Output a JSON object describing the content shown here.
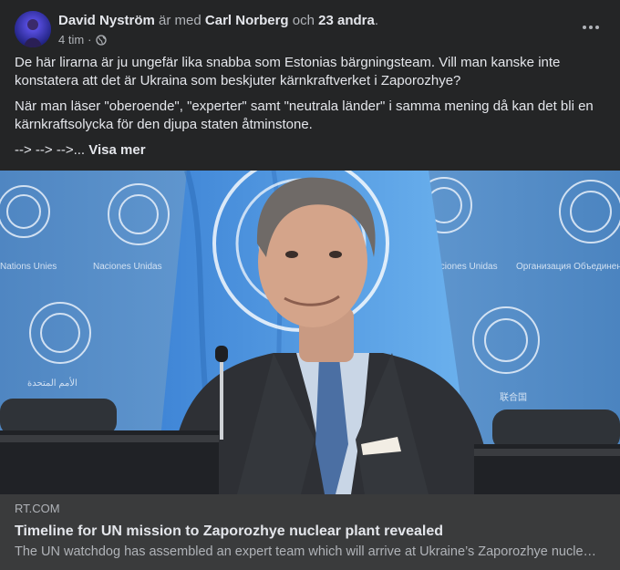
{
  "post": {
    "author": "David Nyström",
    "with_text": "är med",
    "tagged": "Carl Norberg",
    "and_text": "och",
    "others": "23 andra",
    "time": "4 tim",
    "privacy_icon": "globe-icon",
    "more_icon": "more-options-icon",
    "paragraphs": [
      "De här lirarna är ju ungefär lika snabba som Estonias bärgningsteam. Vill man kanske inte konstatera att det är Ukraina som beskjuter kärnkraftverket i Zaporozhye?",
      "När man läser \"oberoende\", \"experter\" samt \"neutrala länder\" i samma mening då kan det bli en kärnkraftsolycka för den djupa staten åtminstone."
    ],
    "arrows": "--> --> -->...",
    "see_more": "Visa mer"
  },
  "link": {
    "domain": "RT.COM",
    "title": "Timeline for UN mission to Zaporozhye nuclear plant revealed",
    "description": "The UN watchdog has assembled an expert team which will arrive at Ukraine’s Zaporozhye nuclear plant"
  },
  "photo": {
    "backdrop_texts": [
      "Naciones Unidas",
      "Organisation des Nations Unies",
      "Nations Unies",
      "Организация Объединенных Наций",
      "联合国",
      "الأمم المتحدة"
    ]
  },
  "colors": {
    "card_bg": "#242526",
    "link_bg": "#3a3b3c",
    "primary_text": "#e4e6eb",
    "secondary_text": "#b0b3b8",
    "un_blue": "#5b91c9"
  }
}
